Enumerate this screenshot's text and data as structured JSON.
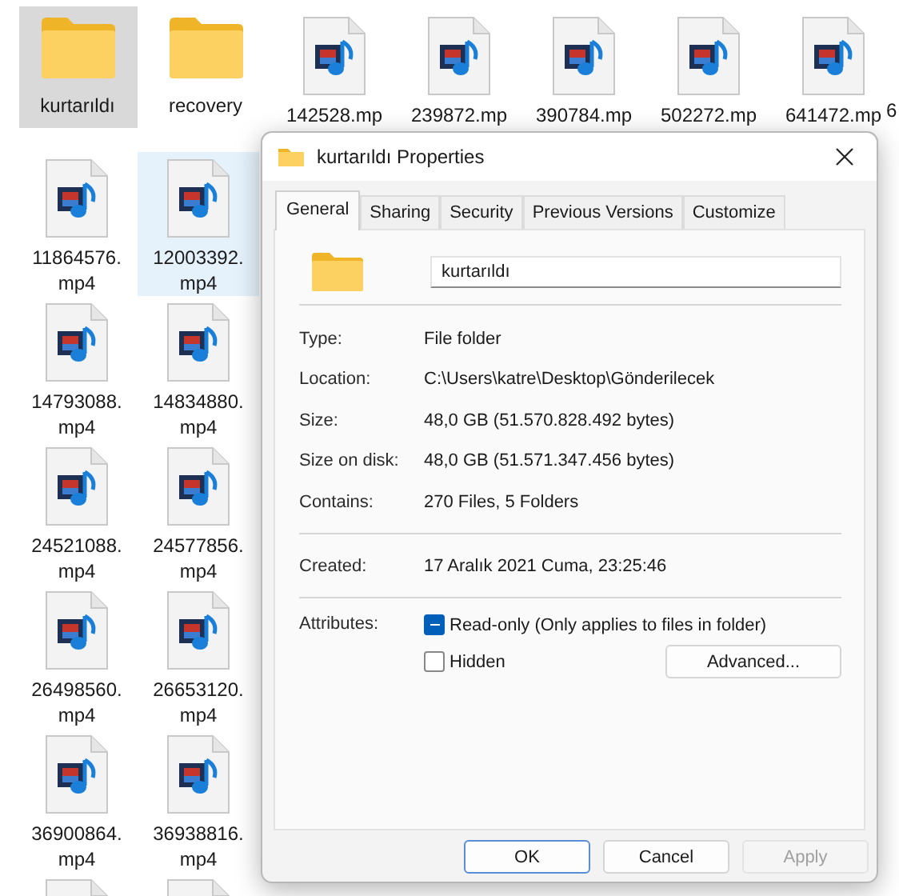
{
  "desktop": {
    "top_row": [
      {
        "kind": "folder",
        "lines": [
          "kurtarıldı"
        ],
        "selected": true,
        "hovered": false
      },
      {
        "kind": "folder",
        "lines": [
          "recovery"
        ],
        "selected": false,
        "hovered": false
      },
      {
        "kind": "video",
        "lines": [
          "142528.mp"
        ],
        "selected": false,
        "hovered": false
      },
      {
        "kind": "video",
        "lines": [
          "239872.mp"
        ],
        "selected": false,
        "hovered": false
      },
      {
        "kind": "video",
        "lines": [
          "390784.mp"
        ],
        "selected": false,
        "hovered": false
      },
      {
        "kind": "video",
        "lines": [
          "502272.mp"
        ],
        "selected": false,
        "hovered": false
      },
      {
        "kind": "video",
        "lines": [
          "641472.mp"
        ],
        "selected": false,
        "hovered": false
      }
    ],
    "edge_label": "6",
    "grid": [
      {
        "kind": "video",
        "lines": [
          "11864576.",
          "mp4"
        ],
        "selected": false,
        "hovered": false
      },
      {
        "kind": "video",
        "lines": [
          "12003392.",
          "mp4"
        ],
        "selected": false,
        "hovered": true
      },
      {
        "kind": "video",
        "lines": [
          "14793088.",
          "mp4"
        ],
        "selected": false,
        "hovered": false
      },
      {
        "kind": "video",
        "lines": [
          "14834880.",
          "mp4"
        ],
        "selected": false,
        "hovered": false
      },
      {
        "kind": "video",
        "lines": [
          "24521088.",
          "mp4"
        ],
        "selected": false,
        "hovered": false
      },
      {
        "kind": "video",
        "lines": [
          "24577856.",
          "mp4"
        ],
        "selected": false,
        "hovered": false
      },
      {
        "kind": "video",
        "lines": [
          "26498560.",
          "mp4"
        ],
        "selected": false,
        "hovered": false
      },
      {
        "kind": "video",
        "lines": [
          "26653120.",
          "mp4"
        ],
        "selected": false,
        "hovered": false
      },
      {
        "kind": "video",
        "lines": [
          "36900864.",
          "mp4"
        ],
        "selected": false,
        "hovered": false
      },
      {
        "kind": "video",
        "lines": [
          "36938816.",
          "mp4"
        ],
        "selected": false,
        "hovered": false
      },
      {
        "kind": "video",
        "selected": false,
        "hovered": false
      },
      {
        "kind": "video",
        "selected": false,
        "hovered": false
      }
    ]
  },
  "dialog": {
    "title": "kurtarıldı Properties",
    "tabs": [
      {
        "label": "General",
        "selected": true
      },
      {
        "label": "Sharing",
        "selected": false
      },
      {
        "label": "Security",
        "selected": false
      },
      {
        "label": "Previous Versions",
        "selected": false
      },
      {
        "label": "Customize",
        "selected": false
      }
    ],
    "name_field": {
      "value": "kurtarıldı"
    },
    "sections": [
      [
        {
          "label": "Type:",
          "value": "File folder"
        },
        {
          "label": "Location:",
          "value": "C:\\Users\\katre\\Desktop\\Gönderilecek"
        },
        {
          "label": "Size:",
          "value": "48,0 GB (51.570.828.492 bytes)"
        },
        {
          "label": "Size on disk:",
          "value": "48,0 GB (51.571.347.456 bytes)"
        },
        {
          "label": "Contains:",
          "value": "270 Files, 5 Folders"
        }
      ],
      [
        {
          "label": "Created:",
          "value": "17 Aralık 2021 Cuma, 23:25:46"
        }
      ]
    ],
    "attributes": {
      "label": "Attributes:",
      "checkboxes": [
        {
          "label": "Read-only (Only applies to files in folder)",
          "indeterminate": true
        },
        {
          "label": "Hidden",
          "checked": false,
          "indeterminate": false
        }
      ],
      "advanced_button": "Advanced..."
    },
    "buttons": [
      {
        "label": "OK",
        "default": true,
        "disabled": false
      },
      {
        "label": "Cancel",
        "default": false,
        "disabled": false
      },
      {
        "label": "Apply",
        "default": false,
        "disabled": true
      }
    ]
  }
}
